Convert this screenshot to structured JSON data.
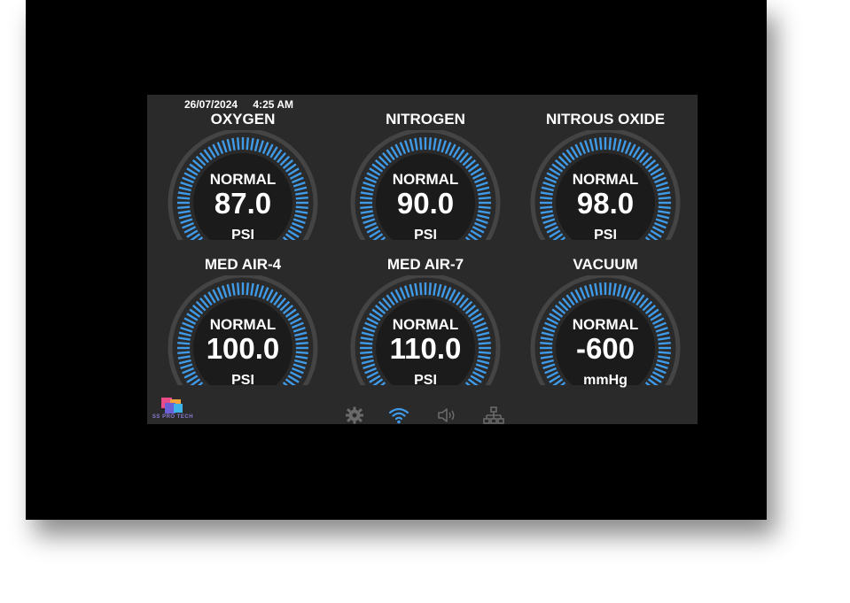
{
  "header": {
    "date": "26/07/2024",
    "time": "4:25 AM"
  },
  "gauges": [
    {
      "title": "OXYGEN",
      "status": "NORMAL",
      "value": "87.0",
      "unit": "PSI"
    },
    {
      "title": "NITROGEN",
      "status": "NORMAL",
      "value": "90.0",
      "unit": "PSI"
    },
    {
      "title": "NITROUS OXIDE",
      "status": "NORMAL",
      "value": "98.0",
      "unit": "PSI"
    },
    {
      "title": "MED AIR-4",
      "status": "NORMAL",
      "value": "100.0",
      "unit": "PSI"
    },
    {
      "title": "MED AIR-7",
      "status": "NORMAL",
      "value": "110.0",
      "unit": "PSI"
    },
    {
      "title": "VACUUM",
      "status": "NORMAL",
      "value": "-600",
      "unit": "mmHg"
    }
  ],
  "brand": {
    "name": "SS PRO TECH"
  },
  "statusbar": {
    "icons": [
      "gear-icon",
      "wifi-icon",
      "speaker-icon",
      "network-icon"
    ]
  },
  "colors": {
    "accent": "#3f9ae8",
    "screen_bg": "#2a2a2a",
    "dial_bg": "#1b1b1b",
    "ring": "#444444"
  }
}
